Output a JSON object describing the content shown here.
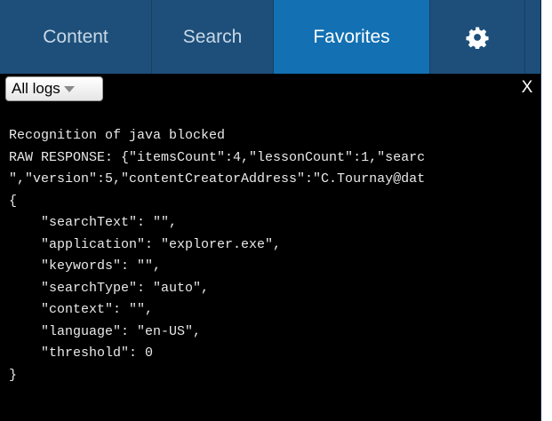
{
  "tabs": [
    {
      "label": "Content",
      "active": false
    },
    {
      "label": "Search",
      "active": false
    },
    {
      "label": "Favorites",
      "active": true
    }
  ],
  "settings_tab": {
    "icon": "gear-icon"
  },
  "toolbar": {
    "filter_value": "All logs",
    "close_label": "X"
  },
  "log": {
    "lines": [
      "Recognition of java blocked",
      "RAW RESPONSE: {\"itemsCount\":4,\"lessonCount\":1,\"searc",
      "\",\"version\":5,\"contentCreatorAddress\":\"C.Tournay@dat",
      "{",
      "    \"searchText\": \"\",",
      "    \"application\": \"explorer.exe\",",
      "    \"keywords\": \"\",",
      "    \"searchType\": \"auto\",",
      "    \"context\": \"\",",
      "    \"language\": \"en-US\",",
      "    \"threshold\": 0",
      "}"
    ]
  },
  "colors": {
    "tabbar": "#1d4f7a",
    "active_tab": "#1270b3",
    "console_background": "#000000",
    "console_text": "#e9e9e9"
  }
}
